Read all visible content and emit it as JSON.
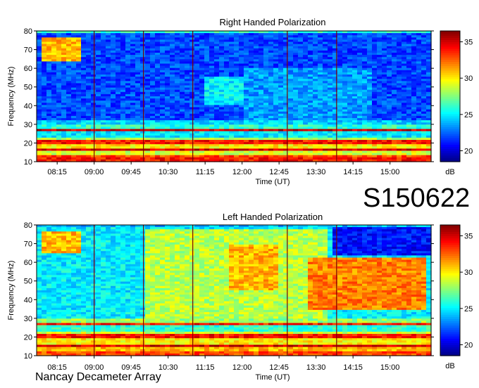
{
  "observation_id": "S150622",
  "instrument": "Nancay Decameter Array",
  "chart_data": [
    {
      "type": "heatmap",
      "title": "Right Handed Polarization",
      "xlabel": "Time (UT)",
      "ylabel": "Frequency (MHz)",
      "xticks": [
        "08:15",
        "09:00",
        "09:45",
        "10:30",
        "11:15",
        "12:00",
        "12:45",
        "13:30",
        "14:15",
        "15:00"
      ],
      "xlim": [
        "07:50",
        "15:50"
      ],
      "yticks": [
        10,
        20,
        30,
        40,
        50,
        60,
        70,
        80
      ],
      "ylim": [
        10,
        80
      ],
      "colorbar": {
        "label": "dB",
        "ticks": [
          20,
          25,
          30,
          35
        ],
        "range": [
          18.5,
          36.5
        ],
        "colormap": "jet"
      },
      "background_level_db": 22,
      "bands": [
        {
          "freq": [
            10,
            12
          ],
          "db": 34
        },
        {
          "freq": [
            12,
            14
          ],
          "db": 33
        },
        {
          "freq": [
            14,
            16
          ],
          "db": 29
        },
        {
          "freq": [
            16,
            17.5
          ],
          "db": 35
        },
        {
          "freq": [
            17.5,
            19
          ],
          "db": 30
        },
        {
          "freq": [
            19,
            22
          ],
          "db": 34
        },
        {
          "freq": [
            22,
            23
          ],
          "db": 28
        },
        {
          "freq": [
            23,
            26
          ],
          "db": 25
        },
        {
          "freq": [
            26,
            28
          ],
          "db": 35
        },
        {
          "freq": [
            28,
            30
          ],
          "db": 26
        },
        {
          "freq": [
            30,
            32
          ],
          "db": 24.5
        },
        {
          "freq": [
            79,
            80
          ],
          "db": 26
        }
      ],
      "events": [
        {
          "t": [
            "07:55",
            "08:45"
          ],
          "freq": [
            64,
            76
          ],
          "db": 31
        },
        {
          "t": [
            "11:15",
            "12:30"
          ],
          "freq": [
            40,
            55
          ],
          "db": 25
        },
        {
          "t": [
            "12:00",
            "14:40"
          ],
          "freq": [
            28,
            60
          ],
          "db": 23.5
        }
      ],
      "vertical_lines": [
        "09:00",
        "10:00",
        "11:00",
        "12:55",
        "13:55"
      ]
    },
    {
      "type": "heatmap",
      "title": "Left Handed Polarization",
      "xlabel": "Time (UT)",
      "ylabel": "Frequency (MHz)",
      "xticks": [
        "08:15",
        "09:00",
        "09:45",
        "10:30",
        "11:15",
        "12:00",
        "12:45",
        "13:30",
        "14:15",
        "15:00"
      ],
      "xlim": [
        "07:50",
        "15:50"
      ],
      "yticks": [
        10,
        20,
        30,
        40,
        50,
        60,
        70,
        80
      ],
      "ylim": [
        10,
        80
      ],
      "colorbar": {
        "label": "dB",
        "ticks": [
          20,
          25,
          30,
          35
        ],
        "range": [
          18.5,
          36.5
        ],
        "colormap": "jet"
      },
      "background_level_db": 25,
      "bands": [
        {
          "freq": [
            10,
            12
          ],
          "db": 33
        },
        {
          "freq": [
            12,
            14.5
          ],
          "db": 31
        },
        {
          "freq": [
            14.5,
            16
          ],
          "db": 35
        },
        {
          "freq": [
            16,
            19
          ],
          "db": 30
        },
        {
          "freq": [
            19,
            21.5
          ],
          "db": 34
        },
        {
          "freq": [
            21.5,
            23
          ],
          "db": 29
        },
        {
          "freq": [
            23,
            26
          ],
          "db": 26
        },
        {
          "freq": [
            26,
            28
          ],
          "db": 34
        },
        {
          "freq": [
            28,
            30
          ],
          "db": 28
        },
        {
          "freq": [
            79,
            80
          ],
          "db": 24
        }
      ],
      "events": [
        {
          "t": [
            "07:55",
            "08:45"
          ],
          "freq": [
            65,
            76
          ],
          "db": 31
        },
        {
          "t": [
            "10:00",
            "13:45"
          ],
          "freq": [
            30,
            78
          ],
          "db": 28.5
        },
        {
          "t": [
            "11:45",
            "12:45"
          ],
          "freq": [
            45,
            70
          ],
          "db": 31
        },
        {
          "t": [
            "13:20",
            "15:45"
          ],
          "freq": [
            35,
            62
          ],
          "db": 32
        },
        {
          "t": [
            "13:50",
            "15:50"
          ],
          "freq": [
            64,
            80
          ],
          "db": 21
        }
      ],
      "vertical_lines": [
        "09:00",
        "10:00",
        "11:00",
        "12:55",
        "13:55"
      ]
    }
  ]
}
